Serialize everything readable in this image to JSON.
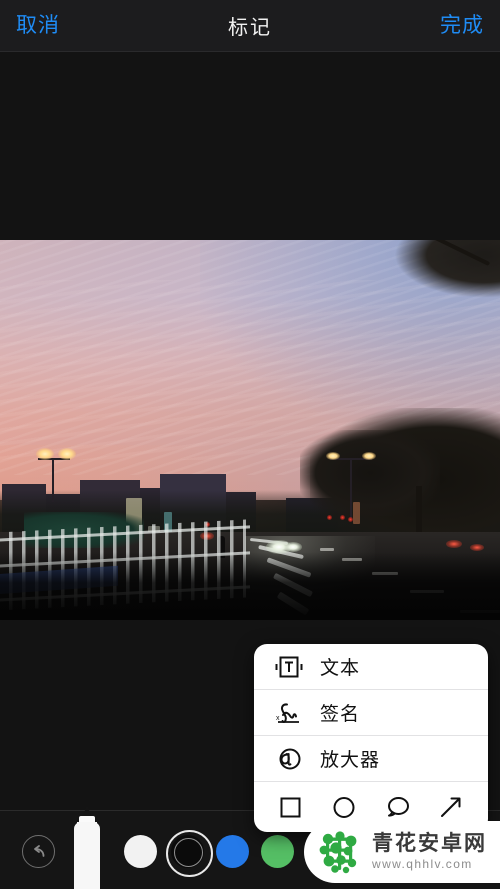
{
  "navbar": {
    "cancel_label": "取消",
    "title": "标记",
    "done_label": "完成",
    "accent_color": "#1f8cf5",
    "title_color": "#f2f2f2"
  },
  "photo": {
    "description": "城市街道日落照片",
    "sky_top_color": "#b9b6cf",
    "sky_bottom_color": "#e98f74",
    "road_color": "#141211"
  },
  "popup_menu": {
    "items": [
      {
        "label": "文本",
        "icon": "text-box-icon"
      },
      {
        "label": "签名",
        "icon": "signature-icon"
      },
      {
        "label": "放大器",
        "icon": "magnifier-icon"
      }
    ],
    "shapes": [
      {
        "name": "square-shape-icon"
      },
      {
        "name": "circle-shape-icon"
      },
      {
        "name": "speech-bubble-shape-icon"
      },
      {
        "name": "arrow-shape-icon"
      }
    ],
    "background_color": "#ffffff",
    "text_color": "#111111"
  },
  "toolbar": {
    "undo_icon": "undo-arrow-icon",
    "active_tool": "marker-pen",
    "tools": [
      {
        "name": "marker-pen",
        "selected": true
      }
    ],
    "colors": [
      {
        "name": "white",
        "hex": "#f2f2f2",
        "selected": false
      },
      {
        "name": "black",
        "hex": "#0b0b0b",
        "selected": true
      },
      {
        "name": "blue",
        "hex": "#2479e8",
        "selected": false
      },
      {
        "name": "green",
        "hex": "#55bf65",
        "selected": false
      }
    ],
    "background_color": "#151515"
  },
  "watermark": {
    "site_name": "青花安卓网",
    "url": "www.qhhlv.com",
    "logo_color": "#2faa43",
    "title_color": "#3a3a3a",
    "url_color": "#8c8c8c"
  }
}
